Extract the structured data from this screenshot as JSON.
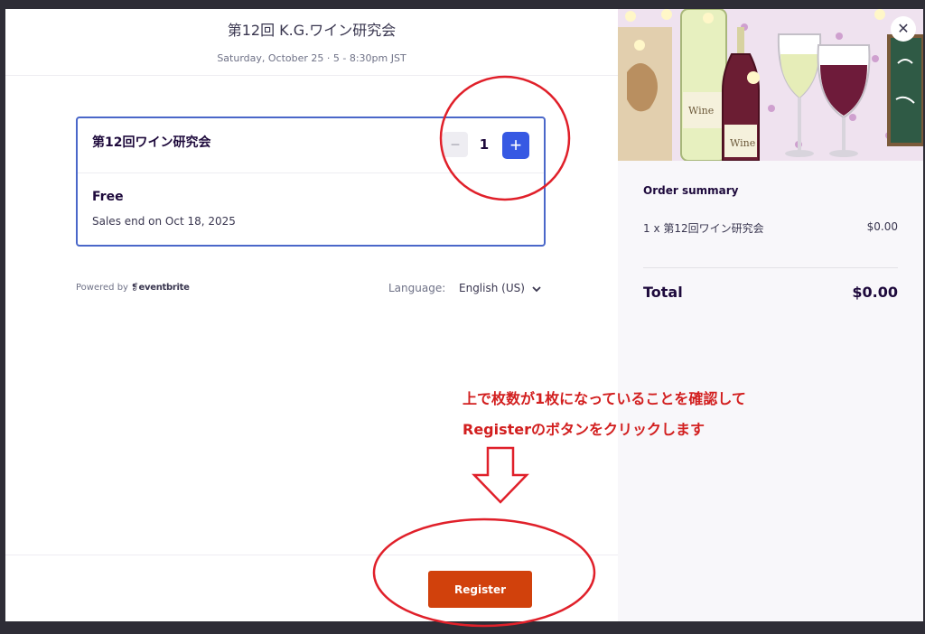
{
  "event": {
    "title": "第12回 K.G.ワイン研究会",
    "date": "Saturday, October 25 · 5 - 8:30pm JST"
  },
  "ticket": {
    "name": "第12回ワイン研究会",
    "quantity": "1",
    "minus_label": "−",
    "plus_label": "+",
    "price": "Free",
    "sales_end": "Sales end on Oct 18, 2025"
  },
  "footer_meta": {
    "powered_by": "Powered by",
    "brand": "eventbrite",
    "language_label": "Language:",
    "language_value": "English (US)"
  },
  "actions": {
    "register_label": "Register",
    "close_label": "✕"
  },
  "banner": {
    "bottle_label": "Wine"
  },
  "order_summary": {
    "title": "Order summary",
    "item": "1 x 第12回ワイン研究会",
    "item_price": "$0.00",
    "total_label": "Total",
    "total_value": "$0.00"
  },
  "annotation": {
    "line1": "上で枚数が1枚になっていることを確認して",
    "line2": "Registerのボタンをクリックします"
  },
  "colors": {
    "accent_blue": "#3659e3",
    "register_orange": "#d1410c",
    "annotation_red": "#d21f1f"
  }
}
